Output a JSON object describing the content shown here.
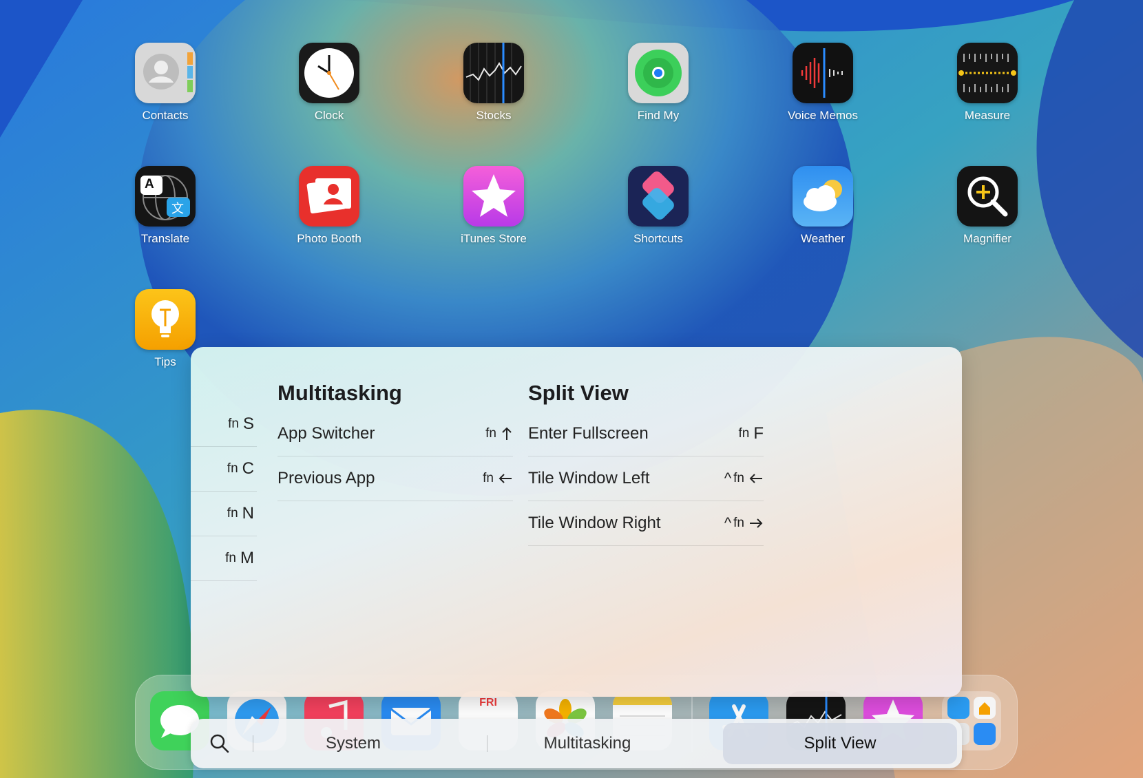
{
  "home_screen": {
    "apps": [
      {
        "label": "Contacts",
        "icon": "contacts-icon"
      },
      {
        "label": "Clock",
        "icon": "clock-icon"
      },
      {
        "label": "Stocks",
        "icon": "stocks-icon"
      },
      {
        "label": "Find My",
        "icon": "find-my-icon"
      },
      {
        "label": "Voice Memos",
        "icon": "voice-memos-icon"
      },
      {
        "label": "Measure",
        "icon": "measure-icon"
      },
      {
        "label": "Translate",
        "icon": "translate-icon"
      },
      {
        "label": "Photo Booth",
        "icon": "photo-booth-icon"
      },
      {
        "label": "iTunes Store",
        "icon": "itunes-store-icon"
      },
      {
        "label": "Shortcuts",
        "icon": "shortcuts-icon"
      },
      {
        "label": "Weather",
        "icon": "weather-icon"
      },
      {
        "label": "Magnifier",
        "icon": "magnifier-icon"
      },
      {
        "label": "Tips",
        "icon": "tips-icon"
      }
    ],
    "translate_glyphs": {
      "latin": "A",
      "cjk": "文"
    }
  },
  "dock": {
    "apps": [
      "messages-icon",
      "safari-icon",
      "music-icon",
      "mail-icon",
      "calendar-icon",
      "photos-icon",
      "notes-icon",
      "app-store-icon",
      "stocks-icon",
      "itunes-store-icon",
      "app-library-icon"
    ],
    "calendar_day": "FRI"
  },
  "shortcuts_overlay": {
    "left_column": [
      {
        "fn": "fn",
        "key": "S"
      },
      {
        "fn": "fn",
        "key": "C"
      },
      {
        "fn": "fn",
        "key": "N"
      },
      {
        "fn": "fn",
        "key": "M"
      }
    ],
    "multitasking": {
      "title": "Multitasking",
      "rows": [
        {
          "label": "App Switcher",
          "fn": "fn",
          "arrow": "up-arrow-icon"
        },
        {
          "label": "Previous App",
          "fn": "fn",
          "arrow": "left-arrow-icon"
        }
      ]
    },
    "split_view": {
      "title": "Split View",
      "rows": [
        {
          "label": "Enter Fullscreen",
          "ctrl": "",
          "fn": "fn",
          "key": "F"
        },
        {
          "label": "Tile Window Left",
          "ctrl": "^",
          "fn": "fn",
          "arrow": "left-arrow-icon"
        },
        {
          "label": "Tile Window Right",
          "ctrl": "^",
          "fn": "fn",
          "arrow": "right-arrow-icon"
        }
      ]
    },
    "tabs": [
      {
        "label": "System"
      },
      {
        "label": "Multitasking"
      },
      {
        "label": "Split View",
        "active": true
      }
    ],
    "colors": {
      "accent": "#1c1c1e",
      "active_tab": "#d2d8e4"
    }
  }
}
